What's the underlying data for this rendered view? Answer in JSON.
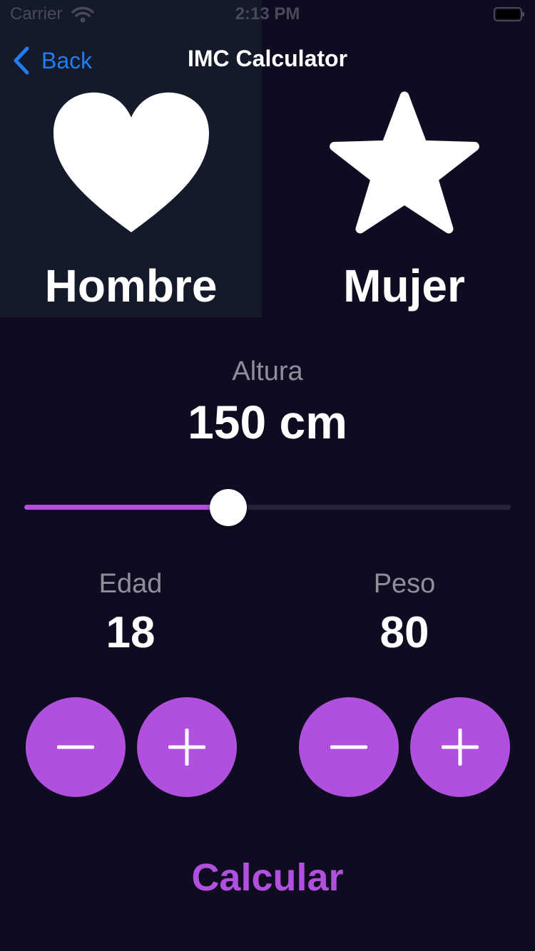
{
  "status_bar": {
    "carrier": "Carrier",
    "time": "2:13 PM",
    "icons": [
      "wifi-icon",
      "battery-icon"
    ]
  },
  "nav": {
    "back_label": "Back",
    "title": "IMC Calculator",
    "back_icon": "chevron-left-icon"
  },
  "gender": {
    "male": {
      "label": "Hombre",
      "icon": "heart-icon",
      "selected": true
    },
    "female": {
      "label": "Mujer",
      "icon": "star-icon",
      "selected": false
    }
  },
  "height": {
    "label": "Altura",
    "value_text": "150 cm",
    "slider_fraction": 0.42
  },
  "age": {
    "label": "Edad",
    "value": "18",
    "buttons": [
      "minus-icon",
      "plus-icon"
    ]
  },
  "weight": {
    "label": "Peso",
    "value": "80",
    "buttons": [
      "minus-icon",
      "plus-icon"
    ]
  },
  "calculate_label": "Calcular",
  "colors": {
    "background": "#0f0c22",
    "selected_card": "#151a2a",
    "accent": "#b150de",
    "link": "#1e7ef6",
    "secondary_text": "#8f8e99"
  }
}
